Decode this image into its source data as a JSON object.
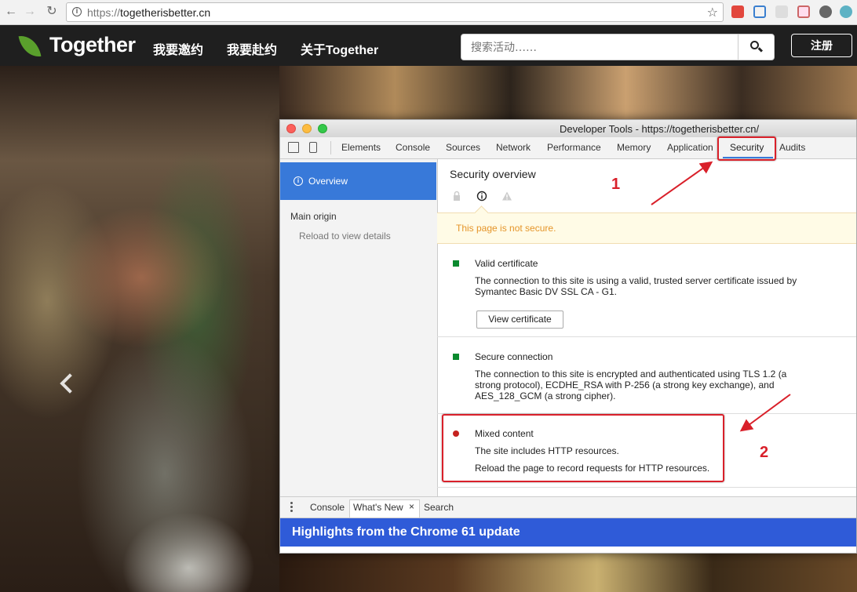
{
  "browser": {
    "url_scheme": "https://",
    "url_host": "togetherisbetter.cn"
  },
  "site": {
    "logo": "Together",
    "nav": [
      "我要邀约",
      "我要赴约",
      "关于Together"
    ],
    "search_placeholder": "搜索活动……",
    "register_label": "注册"
  },
  "devtools": {
    "window_title": "Developer Tools - https://togetherisbetter.cn/",
    "tabs": [
      "Elements",
      "Console",
      "Sources",
      "Network",
      "Performance",
      "Memory",
      "Application",
      "Security",
      "Audits"
    ],
    "active_tab": "Security",
    "sidebar": {
      "overview_label": "Overview",
      "main_origin_label": "Main origin",
      "reload_hint": "Reload to view details"
    },
    "main": {
      "title": "Security overview",
      "not_secure_text": "This page is not secure.",
      "sections": [
        {
          "title": "Valid certificate",
          "desc": "The connection to this site is using a valid, trusted server certificate issued by Symantec Basic DV SSL CA - G1.",
          "button": "View certificate",
          "status_color": "#0a8a2e"
        },
        {
          "title": "Secure connection",
          "desc": "The connection to this site is encrypted and authenticated using TLS 1.2 (a strong protocol), ECDHE_RSA with P-256 (a strong key exchange), and AES_128_GCM (a strong cipher).",
          "status_color": "#0a8a2e"
        },
        {
          "title": "Mixed content",
          "desc1": "The site includes HTTP resources.",
          "desc2": "Reload the page to record requests for HTTP resources.",
          "status_color": "#c5221f"
        }
      ]
    },
    "drawer": {
      "tabs": [
        "Console",
        "What's New",
        "Search"
      ],
      "active_tab": "What's New",
      "close_glyph": "×",
      "banner": "Highlights from the Chrome 61 update"
    }
  },
  "annotations": {
    "label_1": "1",
    "label_2": "2",
    "color": "#d9202a"
  }
}
